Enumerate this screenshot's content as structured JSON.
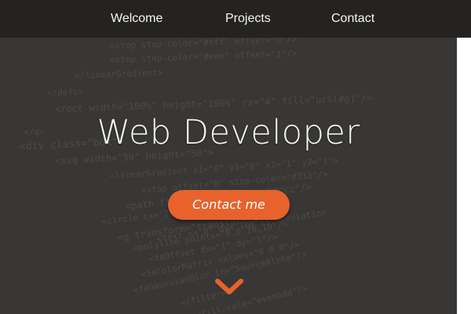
{
  "nav": {
    "items": [
      {
        "label": "Welcome"
      },
      {
        "label": "Projects"
      },
      {
        "label": "Contact"
      }
    ]
  },
  "hero": {
    "title": "Web Developer",
    "cta_label": "Contact me",
    "scroll_icon": "chevron-down-icon"
  },
  "background_code": [
    "<stop stop-color=\"#fff\" offset=\"0\"/>",
    "<stop stop-color=\"#eee\" offset=\"1\"/>",
    "</linearGradient>",
    "</defs>",
    "<rect width=\"100%\" height=\"100%\" rx=\"4\" fill=\"url(#g)\"/>",
    "</g>",
    "<div class=\"box\">",
    "<svg width=\"50\" height=\"50\">",
    "<linearGradient x1=\"0\" y1=\"0\" x2=\"1\" y2=\"1\">",
    "<stop offset=\"0\" stop-color=\"#333\"/>",
    "<path fill=\"none\" stroke=\"#ccc\"/>",
    "<circle cx=\"25\" cy=\"25\" r=\"20\"/>",
    "<g transform=\"translate(0,0)\">",
    "<polyline points=\"0,0 10,10\"/>",
    "<text x=\"0\" dy=\"1em\">stdDeviation",
    "<feOffset dx=\"1\" dy=\"1\"/>",
    "<feColorMatrix values=\"0 0 0\"/>",
    "<feGaussianBlur in=\"SourceAlpha\"/>",
    "</filter>",
    "<fill-rule=\"evenodd\"/>"
  ],
  "colors": {
    "nav_background": "#242321",
    "hero_background": "#383735",
    "accent": "#e8622c",
    "text_light": "#f6f6f4"
  }
}
